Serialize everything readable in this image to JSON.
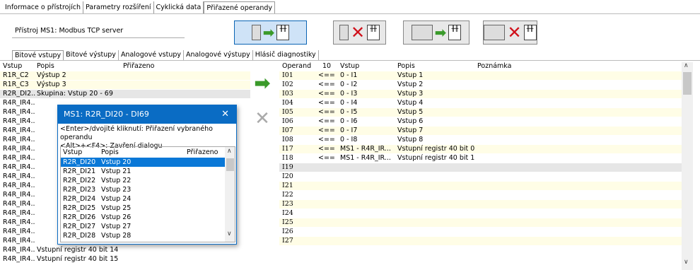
{
  "top_tabs": [
    "Informace o přístrojích",
    "Parametry rozšíření",
    "Cyklická data",
    "Přiřazené operandy"
  ],
  "device_label": "Přístroj MS1: Modbus TCP server",
  "sub_tabs": [
    "Bitové vstupy",
    "Bitové výstupy",
    "Analogové vstupy",
    "Analogové výstupy",
    "Hlásič diagnostiky"
  ],
  "left_table": {
    "headers": {
      "vstup": "Vstup",
      "popis": "Popis",
      "prirazeno": "Přiřazeno"
    },
    "rows": [
      {
        "vstup": "R1R_C2",
        "popis": "Výstup 2"
      },
      {
        "vstup": "R1R_C3",
        "popis": "Výstup 3"
      },
      {
        "vstup": "R2R_DI2...",
        "popis": "Skupina: Vstup 20 -  69"
      },
      {
        "vstup": "R4R_IR4...",
        "popis": ""
      },
      {
        "vstup": "R4R_IR4...",
        "popis": ""
      },
      {
        "vstup": "R4R_IR4...",
        "popis": ""
      },
      {
        "vstup": "R4R_IR4...",
        "popis": ""
      },
      {
        "vstup": "R4R_IR4...",
        "popis": ""
      },
      {
        "vstup": "R4R_IR4...",
        "popis": ""
      },
      {
        "vstup": "R4R_IR4...",
        "popis": ""
      },
      {
        "vstup": "R4R_IR4...",
        "popis": ""
      },
      {
        "vstup": "R4R_IR4...",
        "popis": ""
      },
      {
        "vstup": "R4R_IR4...",
        "popis": ""
      },
      {
        "vstup": "R4R_IR4...",
        "popis": ""
      },
      {
        "vstup": "R4R_IR4...",
        "popis": ""
      },
      {
        "vstup": "R4R_IR4...",
        "popis": ""
      },
      {
        "vstup": "R4R_IR4...",
        "popis": ""
      },
      {
        "vstup": "R4R_IR4...",
        "popis": ""
      },
      {
        "vstup": "R4R_IR4...",
        "popis": ""
      },
      {
        "vstup": "R4R_IR4...",
        "popis": "Vstupní registr 40 bit 14"
      },
      {
        "vstup": "R4R_IR4...",
        "popis": "Vstupní registr 40 bit 15"
      }
    ]
  },
  "right_table": {
    "headers": {
      "operand": "Operand",
      "n": "10",
      "vstup": "Vstup",
      "popis": "Popis",
      "poznamka": "Poznámka"
    },
    "rows": [
      {
        "operand": "I01",
        "arrow": "<==",
        "vstup": "0 - I1",
        "popis": "Vstup 1"
      },
      {
        "operand": "I02",
        "arrow": "<==",
        "vstup": "0 - I2",
        "popis": "Vstup 2"
      },
      {
        "operand": "I03",
        "arrow": "<==",
        "vstup": "0 - I3",
        "popis": "Vstup 3"
      },
      {
        "operand": "I04",
        "arrow": "<==",
        "vstup": "0 - I4",
        "popis": "Vstup 4"
      },
      {
        "operand": "I05",
        "arrow": "<==",
        "vstup": "0 - I5",
        "popis": "Vstup 5"
      },
      {
        "operand": "I06",
        "arrow": "<==",
        "vstup": "0 - I6",
        "popis": "Vstup 6"
      },
      {
        "operand": "I07",
        "arrow": "<==",
        "vstup": "0 - I7",
        "popis": "Vstup 7"
      },
      {
        "operand": "I08",
        "arrow": "<==",
        "vstup": "0 - I8",
        "popis": "Vstup 8"
      },
      {
        "operand": "I17",
        "arrow": "<==",
        "vstup": "MS1 - R4R_IR...",
        "popis": "Vstupní registr 40 bit 0"
      },
      {
        "operand": "I18",
        "arrow": "<==",
        "vstup": "MS1 - R4R_IR...",
        "popis": "Vstupní registr 40 bit 1"
      },
      {
        "operand": "I19",
        "arrow": "",
        "vstup": "",
        "popis": ""
      },
      {
        "operand": "I20",
        "arrow": "",
        "vstup": "",
        "popis": ""
      },
      {
        "operand": "I21",
        "arrow": "",
        "vstup": "",
        "popis": ""
      },
      {
        "operand": "I22",
        "arrow": "",
        "vstup": "",
        "popis": ""
      },
      {
        "operand": "I23",
        "arrow": "",
        "vstup": "",
        "popis": ""
      },
      {
        "operand": "I24",
        "arrow": "",
        "vstup": "",
        "popis": ""
      },
      {
        "operand": "I25",
        "arrow": "",
        "vstup": "",
        "popis": ""
      },
      {
        "operand": "I26",
        "arrow": "",
        "vstup": "",
        "popis": ""
      },
      {
        "operand": "I27",
        "arrow": "",
        "vstup": "",
        "popis": ""
      }
    ]
  },
  "popup": {
    "title": "MS1: R2R_DI20 - DI69",
    "close": "✕",
    "help_line1": "<Enter>/dvojité kliknutí: Přiřazení vybraného operandu",
    "help_line2": "<Alt>+<F4>: Zavření dialogu",
    "headers": {
      "vstup": "Vstup",
      "popis": "Popis",
      "prirazeno": "Přiřazeno"
    },
    "rows": [
      {
        "vstup": "R2R_DI20",
        "popis": "Vstup 20"
      },
      {
        "vstup": "R2R_DI21",
        "popis": "Vstup 21"
      },
      {
        "vstup": "R2R_DI22",
        "popis": "Vstup 22"
      },
      {
        "vstup": "R2R_DI23",
        "popis": "Vstup 23"
      },
      {
        "vstup": "R2R_DI24",
        "popis": "Vstup 24"
      },
      {
        "vstup": "R2R_DI25",
        "popis": "Vstup 25"
      },
      {
        "vstup": "R2R_DI26",
        "popis": "Vstup 26"
      },
      {
        "vstup": "R2R_DI27",
        "popis": "Vstup 27"
      },
      {
        "vstup": "R2R_DI28",
        "popis": "Vstup 28"
      }
    ]
  },
  "icons": {
    "assign": "green-arrow-icon",
    "unassign": "red-x-icon",
    "plc": "plc-module-icon",
    "arrow_color": "#3a9a2a",
    "x_color": "#d0101a",
    "selection_color": "#0a78d7",
    "title_color": "#0a6cc4"
  },
  "glyphs": {
    "arrow": "➡",
    "x": "✕",
    "plc": "╫╫",
    "up": "∧",
    "down": "∨"
  }
}
